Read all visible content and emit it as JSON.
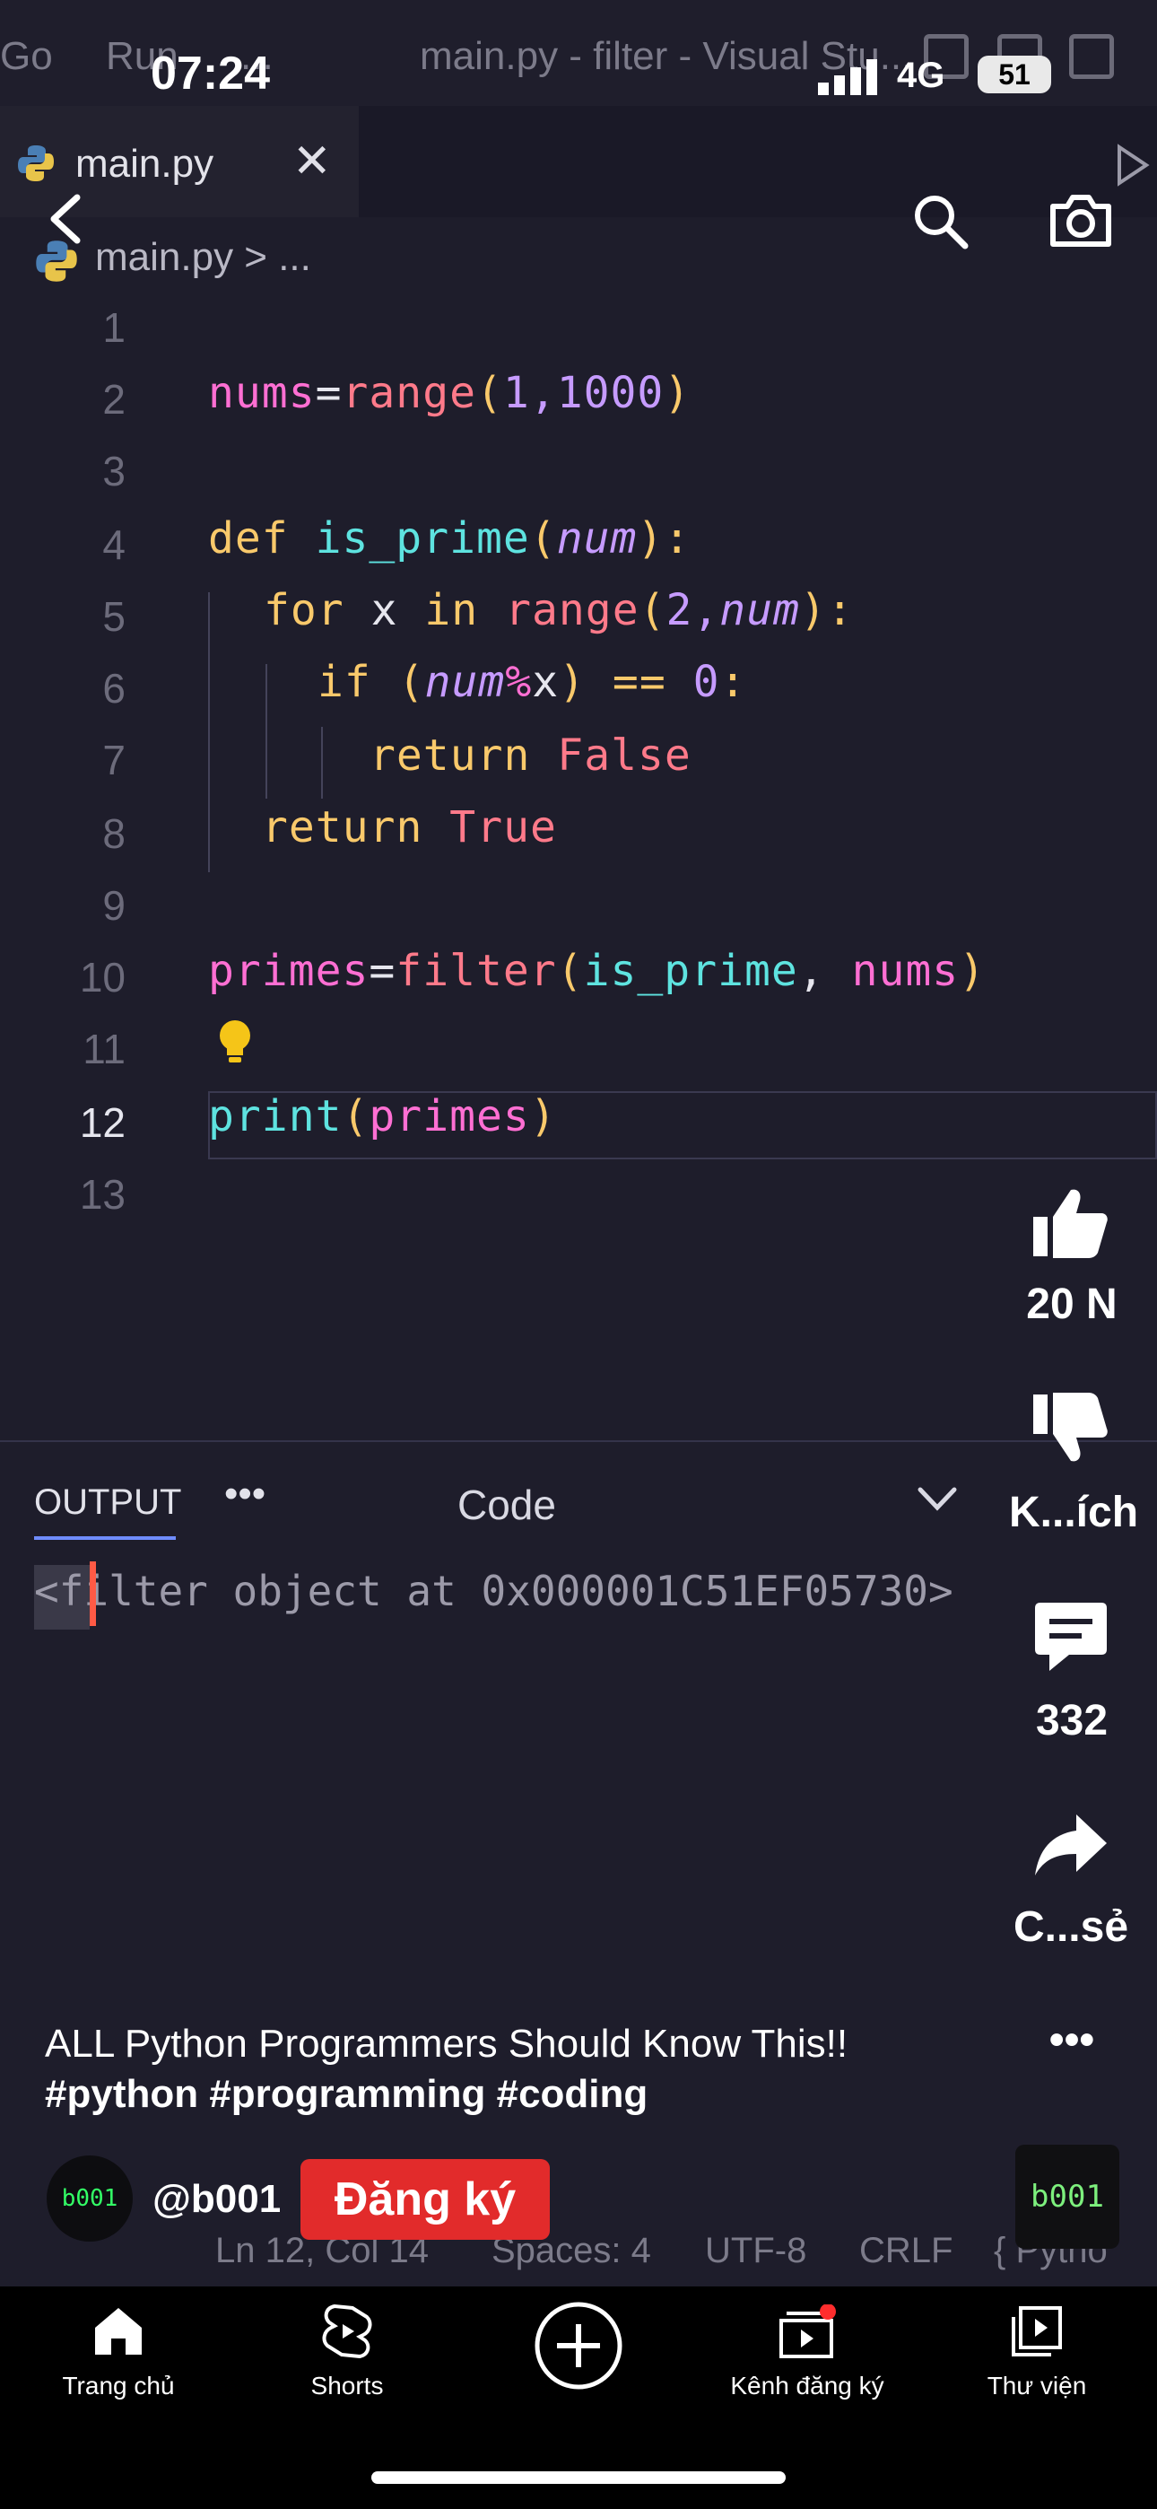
{
  "status_bar": {
    "time": "07:24",
    "network": "4G",
    "battery": "51"
  },
  "vscode": {
    "menu": [
      "Go",
      "Run",
      "..."
    ],
    "window_title": "main.py - filter - Visual Stu...",
    "tab": {
      "label": "main.py",
      "close": "✕"
    },
    "breadcrumb": "main.py > ...",
    "line_numbers": [
      "1",
      "2",
      "3",
      "4",
      "5",
      "6",
      "7",
      "8",
      "9",
      "10",
      "11",
      "12",
      "13"
    ],
    "code": {
      "l2": [
        "nums",
        "=",
        "range",
        "(",
        "1,1000",
        ")"
      ],
      "l4": [
        "def ",
        "is_prime",
        "(",
        "num",
        "):"
      ],
      "l5": [
        "for ",
        "x ",
        "in ",
        "range",
        "(",
        "2,",
        "num",
        "):"
      ],
      "l6": [
        "if ",
        "(",
        "num",
        "%",
        "x",
        ") == ",
        "0",
        ":"
      ],
      "l7": [
        "return ",
        "False"
      ],
      "l8": [
        "return ",
        "True"
      ],
      "l10": [
        "primes",
        "=",
        "filter",
        "(",
        "is_prime",
        ", ",
        "nums",
        ")"
      ],
      "l12": [
        "print",
        "(",
        "primes",
        ")"
      ]
    },
    "panel": {
      "tab": "OUTPUT",
      "more": "•••",
      "selector": "Code",
      "output": "<filter object at 0x000001C51EF05730>"
    },
    "status": {
      "position": "Ln 12, Col 14",
      "spaces": "Spaces: 4",
      "encoding": "UTF-8",
      "eol": "CRLF",
      "lang": "{ Pytho"
    }
  },
  "shorts": {
    "likes": "20 N",
    "dislike_label": "K...ích",
    "comments": "332",
    "share_label": "C...sẻ",
    "more": "•••",
    "title": "ALL Python Programmers Should Know This!!",
    "hashtags": "#python #programming #coding",
    "channel": "@b001",
    "avatar_text": "b001",
    "subscribe_label": "Đăng ký",
    "thumb_text": "b001"
  },
  "nav": {
    "home": "Trang chủ",
    "shorts": "Shorts",
    "subscriptions": "Kênh đăng ký",
    "library": "Thư viện"
  }
}
